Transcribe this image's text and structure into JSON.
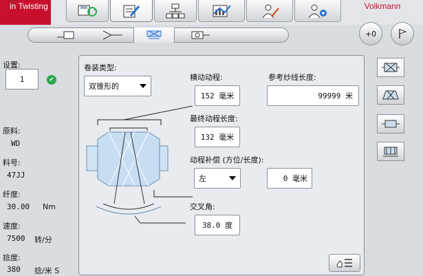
{
  "brand": {
    "text": "in Twisting",
    "logo": "Volkmann"
  },
  "top_tabs": [
    {
      "icon": "save-refresh-icon"
    },
    {
      "icon": "edit-document-icon"
    },
    {
      "icon": "network-icon"
    },
    {
      "icon": "chart-icon"
    },
    {
      "icon": "user-tools-icon"
    },
    {
      "icon": "operator-settings-icon"
    }
  ],
  "sub_tabs": [
    {
      "icon": "spindle-icon"
    },
    {
      "icon": "yarn-path-icon"
    },
    {
      "icon": "winding-icon"
    },
    {
      "icon": "bobbin-icon"
    }
  ],
  "right_buttons": {
    "back_label": "+0"
  },
  "left_panel": {
    "setting_label": "设置:",
    "setting_value": "1",
    "material_label": "原料:",
    "material_value": "WD",
    "material_no_label": "料号:",
    "material_no_value": "47JJ",
    "twist_label": "纤度:",
    "twist_value": "30.00",
    "twist_unit": "Nm",
    "speed_label": "速度:",
    "speed_value": "7500",
    "speed_unit": "转/分",
    "twist2_label": "捻度:",
    "twist2_value": "380",
    "twist2_unit": "捻/米 S"
  },
  "main": {
    "winding_type_label": "卷装类型:",
    "winding_type_value": "双锥形的",
    "traverse_label": "横动动程:",
    "traverse_value": "152 毫米",
    "ref_length_label": "参考纱线长度:",
    "ref_length_value": "99999 米",
    "final_traverse_label": "最终动程长度:",
    "final_traverse_value": "132 毫米",
    "compensation_label": "动程补偿 (方位/长度):",
    "compensation_dir": "左",
    "compensation_len": "0 毫米",
    "cross_angle_label": "交叉角:",
    "cross_angle_value": "38.0 度"
  },
  "side_icons": [
    "bobbin-front-icon",
    "bobbin-cone-icon",
    "bobbin-flat-icon",
    "bobbin-drum-icon"
  ]
}
